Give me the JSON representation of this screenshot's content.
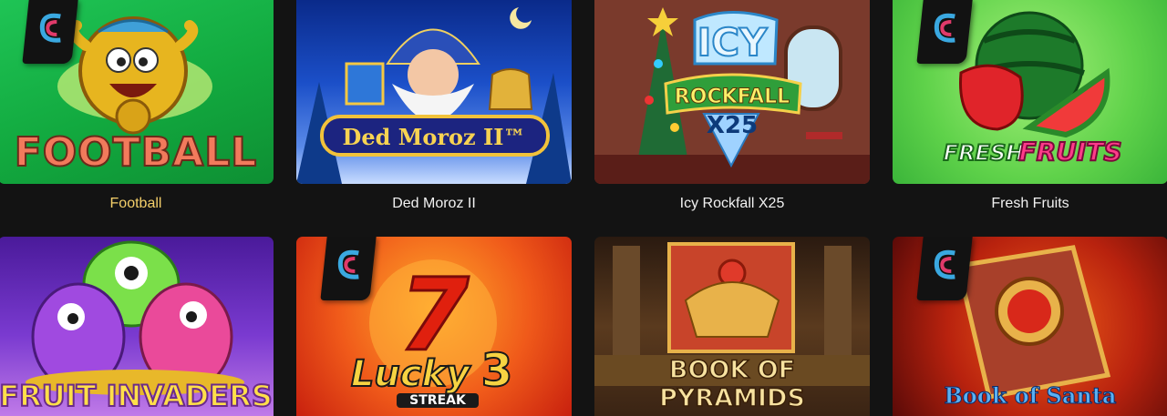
{
  "games": [
    {
      "id": "football",
      "title": "Football",
      "art_title": "FOOTBALL",
      "active": true
    },
    {
      "id": "ded-moroz",
      "title": "Ded Moroz II",
      "art_title": "Ded Moroz II™"
    },
    {
      "id": "icy-rockfall",
      "title": "Icy Rockfall X25",
      "art_title_top": "ICY",
      "art_title_mid": "ROCKFALL",
      "art_title_bot": "X25"
    },
    {
      "id": "fresh-fruits",
      "title": "Fresh Fruits",
      "art_title_a": "FRESH",
      "art_title_b": "FRUITS"
    },
    {
      "id": "fruit-invaders",
      "art_title": "FRUIT INVADERS"
    },
    {
      "id": "lucky-streak",
      "art_title_num": "7",
      "art_title_a": "Lucky",
      "art_title_b": "3",
      "art_title_c": "STREAK"
    },
    {
      "id": "book-of-pyramids",
      "art_title": "BOOK OF PYRAMIDS"
    },
    {
      "id": "book-of-santa",
      "art_title": "Book of Santa"
    }
  ],
  "colors": {
    "background": "#131313",
    "active_caption": "#f4cf6a",
    "caption": "#f2f2f2"
  },
  "provider_badge_icon": "provider-logo-icon"
}
